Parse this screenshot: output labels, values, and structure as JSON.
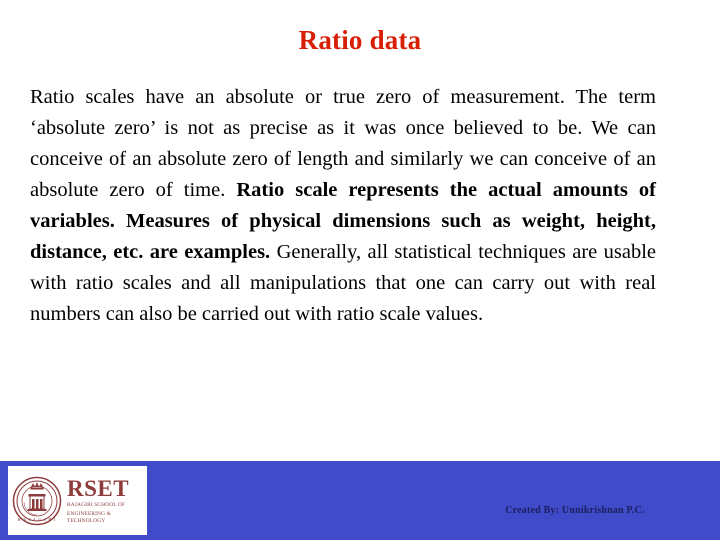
{
  "slide": {
    "title": "Ratio data",
    "title_color": "#D81E05",
    "background_color": "#FFFFFF",
    "body_paragraph": {
      "segments": [
        {
          "text": "Ratio scales have an absolute or true zero of measurement. The term ‘absolute zero’ is not as precise as it was once believed to be. We can conceive of an absolute zero of length and similarly we can conceive of an absolute zero of time. ",
          "bold": false
        },
        {
          "text": "Ratio scale represents the actual amounts of variables. Measures of physical dimensions such as weight, height, distance, etc. are examples. ",
          "bold": true
        },
        {
          "text": "Generally, all statistical techniques are usable with ratio scales and all manipulations that one can carry out with real numbers can also be carried out with ratio scale values.",
          "bold": false
        }
      ]
    }
  },
  "footer": {
    "band_color": "#3F4BC8",
    "logo": {
      "acronym": "RSET",
      "subtitle_line1": "RAJAGIRI SCHOOL OF",
      "subtitle_line2": "ENGINEERING & TECHNOLOGY",
      "crest_motto": "RAJAGIRI",
      "color": "#8E3B3B"
    },
    "credit_text": "Created By: Unnikrishnan P.C.",
    "credit_color": "#1C2060"
  }
}
